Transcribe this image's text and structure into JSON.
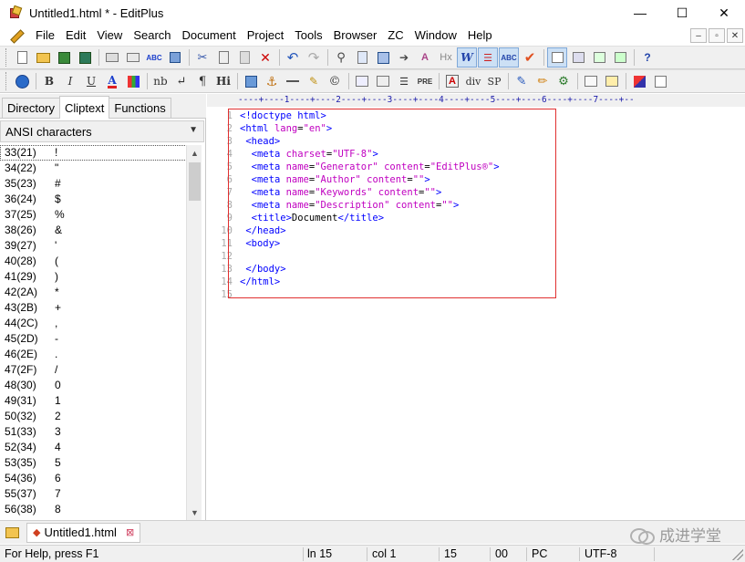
{
  "window": {
    "title": "Untitled1.html * - EditPlus",
    "controls": [
      "—",
      "☐",
      "✕"
    ]
  },
  "menu": [
    "File",
    "Edit",
    "View",
    "Search",
    "Document",
    "Project",
    "Tools",
    "Browser",
    "ZC",
    "Window",
    "Help"
  ],
  "mdi_controls": [
    "–",
    "▫",
    "✕"
  ],
  "toolbar1": {
    "icons": [
      "new-file-icon",
      "open-folder-icon",
      "save-icon",
      "save-all-icon",
      "print-icon",
      "print-preview-icon",
      "spell-check-icon",
      "word-wrap-toggle-icon",
      "cut-icon",
      "copy-icon",
      "paste-icon",
      "delete-icon",
      "undo-icon",
      "redo-icon",
      "find-icon",
      "replace-icon",
      "find-in-files-icon",
      "goto-icon",
      "highlight-icon",
      "hx-icon",
      "word-wrap-icon",
      "line-number-icon",
      "column-select-icon",
      "check-icon",
      "ruler-toggle-icon",
      "output-window-icon",
      "browser-icon",
      "directory-icon",
      "help-icon"
    ],
    "labels": {
      "hx": "Hx",
      "w": "W"
    }
  },
  "toolbar2": {
    "labels": {
      "bold": "B",
      "italic": "I",
      "underline": "U",
      "font": "A",
      "nbsp": "nb",
      "newline": "↵",
      "para": "¶",
      "heading": "Hi",
      "pre": "PRE",
      "div": "div",
      "span": "SP"
    }
  },
  "left_panel": {
    "tabs": [
      "Directory",
      "Cliptext",
      "Functions"
    ],
    "selected_tab": "Cliptext",
    "combo_value": "ANSI characters",
    "characters": [
      {
        "code": "33(21)",
        "char": "!"
      },
      {
        "code": "34(22)",
        "char": "\""
      },
      {
        "code": "35(23)",
        "char": "#"
      },
      {
        "code": "36(24)",
        "char": "$"
      },
      {
        "code": "37(25)",
        "char": "%"
      },
      {
        "code": "38(26)",
        "char": "&"
      },
      {
        "code": "39(27)",
        "char": "'"
      },
      {
        "code": "40(28)",
        "char": "("
      },
      {
        "code": "41(29)",
        "char": ")"
      },
      {
        "code": "42(2A)",
        "char": "*"
      },
      {
        "code": "43(2B)",
        "char": "+"
      },
      {
        "code": "44(2C)",
        "char": ","
      },
      {
        "code": "45(2D)",
        "char": "-"
      },
      {
        "code": "46(2E)",
        "char": "."
      },
      {
        "code": "47(2F)",
        "char": "/"
      },
      {
        "code": "48(30)",
        "char": "0"
      },
      {
        "code": "49(31)",
        "char": "1"
      },
      {
        "code": "50(32)",
        "char": "2"
      },
      {
        "code": "51(33)",
        "char": "3"
      },
      {
        "code": "52(34)",
        "char": "4"
      },
      {
        "code": "53(35)",
        "char": "5"
      },
      {
        "code": "54(36)",
        "char": "6"
      },
      {
        "code": "55(37)",
        "char": "7"
      },
      {
        "code": "56(38)",
        "char": "8"
      }
    ]
  },
  "editor": {
    "ruler": "----+----1----+----2----+----3----+----4----+----5----+----6----+----7----+--",
    "line_numbers": [
      "1",
      "2",
      "3",
      "4",
      "5",
      "6",
      "7",
      "8",
      "9",
      "10",
      "11",
      "12",
      "13",
      "14",
      "15"
    ],
    "lines": [
      [
        {
          "t": "tag",
          "v": "<!doctype html>"
        }
      ],
      [
        {
          "t": "tag",
          "v": "<html "
        },
        {
          "t": "attr",
          "v": "lang"
        },
        {
          "t": "op",
          "v": "="
        },
        {
          "t": "str",
          "v": "\"en\""
        },
        {
          "t": "tag",
          "v": ">"
        }
      ],
      [
        {
          "t": "txt",
          "v": " "
        },
        {
          "t": "tag",
          "v": "<head>"
        }
      ],
      [
        {
          "t": "txt",
          "v": "  "
        },
        {
          "t": "tag",
          "v": "<meta "
        },
        {
          "t": "attr",
          "v": "charset"
        },
        {
          "t": "op",
          "v": "="
        },
        {
          "t": "str",
          "v": "\"UTF-8\""
        },
        {
          "t": "tag",
          "v": ">"
        }
      ],
      [
        {
          "t": "txt",
          "v": "  "
        },
        {
          "t": "tag",
          "v": "<meta "
        },
        {
          "t": "attr",
          "v": "name"
        },
        {
          "t": "op",
          "v": "="
        },
        {
          "t": "str",
          "v": "\"Generator\""
        },
        {
          "t": "txt",
          "v": " "
        },
        {
          "t": "attr",
          "v": "content"
        },
        {
          "t": "op",
          "v": "="
        },
        {
          "t": "str",
          "v": "\"EditPlus®\""
        },
        {
          "t": "tag",
          "v": ">"
        }
      ],
      [
        {
          "t": "txt",
          "v": "  "
        },
        {
          "t": "tag",
          "v": "<meta "
        },
        {
          "t": "attr",
          "v": "name"
        },
        {
          "t": "op",
          "v": "="
        },
        {
          "t": "str",
          "v": "\"Author\""
        },
        {
          "t": "txt",
          "v": " "
        },
        {
          "t": "attr",
          "v": "content"
        },
        {
          "t": "op",
          "v": "="
        },
        {
          "t": "str",
          "v": "\"\""
        },
        {
          "t": "tag",
          "v": ">"
        }
      ],
      [
        {
          "t": "txt",
          "v": "  "
        },
        {
          "t": "tag",
          "v": "<meta "
        },
        {
          "t": "attr",
          "v": "name"
        },
        {
          "t": "op",
          "v": "="
        },
        {
          "t": "str",
          "v": "\"Keywords\""
        },
        {
          "t": "txt",
          "v": " "
        },
        {
          "t": "attr",
          "v": "content"
        },
        {
          "t": "op",
          "v": "="
        },
        {
          "t": "str",
          "v": "\"\""
        },
        {
          "t": "tag",
          "v": ">"
        }
      ],
      [
        {
          "t": "txt",
          "v": "  "
        },
        {
          "t": "tag",
          "v": "<meta "
        },
        {
          "t": "attr",
          "v": "name"
        },
        {
          "t": "op",
          "v": "="
        },
        {
          "t": "str",
          "v": "\"Description\""
        },
        {
          "t": "txt",
          "v": " "
        },
        {
          "t": "attr",
          "v": "content"
        },
        {
          "t": "op",
          "v": "="
        },
        {
          "t": "str",
          "v": "\"\""
        },
        {
          "t": "tag",
          "v": ">"
        }
      ],
      [
        {
          "t": "txt",
          "v": "  "
        },
        {
          "t": "tag",
          "v": "<title>"
        },
        {
          "t": "txt",
          "v": "Document"
        },
        {
          "t": "tag",
          "v": "</title>"
        }
      ],
      [
        {
          "t": "txt",
          "v": " "
        },
        {
          "t": "tag",
          "v": "</head>"
        }
      ],
      [
        {
          "t": "txt",
          "v": " "
        },
        {
          "t": "tag",
          "v": "<body>"
        }
      ],
      [],
      [
        {
          "t": "txt",
          "v": " "
        },
        {
          "t": "tag",
          "v": "</body>"
        }
      ],
      [
        {
          "t": "tag",
          "v": "</html>"
        }
      ],
      []
    ]
  },
  "file_tabs": [
    {
      "label": "Untitled1.html",
      "modified": true
    }
  ],
  "watermark": "成进学堂",
  "status": {
    "help": "For Help, press F1",
    "line": "ln 15",
    "col": "col 1",
    "num": "15",
    "ovr": "00",
    "mode": "PC",
    "encoding": "UTF-8"
  },
  "colors": {
    "tag": "#0000ff",
    "attr": "#c000c0",
    "string": "#c000c0",
    "highlight_box": "#e03030"
  }
}
